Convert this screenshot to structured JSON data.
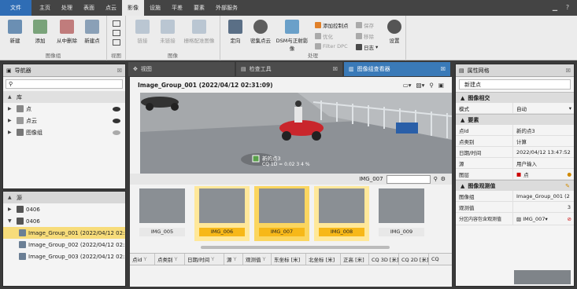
{
  "menu": {
    "tabs": [
      "文件",
      "主页",
      "处理",
      "表面",
      "点云",
      "影像",
      "设施",
      "平差",
      "要素",
      "外部服务"
    ],
    "active": "影像"
  },
  "ribbon": {
    "groups": [
      {
        "label": "图像组",
        "buttons": [
          "新建",
          "添加",
          "从中删除",
          "新建点"
        ]
      },
      {
        "label": "视图",
        "buttons": []
      },
      {
        "label": "图像",
        "buttons": [
          "链接",
          "未链接",
          "栅格配准图像"
        ]
      },
      {
        "label": "处理",
        "buttons": [
          "定向",
          "密集点云",
          "DSM与正射影像"
        ]
      }
    ],
    "small": {
      "add_cp": "添加控制点",
      "save": "保存",
      "optimize": "优化",
      "remove": "移除",
      "filter_dpc": "Filter DPC",
      "log": "日志",
      "settings": "设置"
    }
  },
  "navigator": {
    "title": "导航器",
    "library_label": "库",
    "library_items": [
      "点",
      "点云",
      "图像组"
    ],
    "source_label": "源",
    "source_items": [
      "0406",
      "0406"
    ],
    "groups": [
      "Image_Group_001 (2022/04/12 02:",
      "Image_Group_002 (2022/04/12 02:",
      "Image_Group_003 (2022/04/12 02:"
    ]
  },
  "center_tabs": [
    "视图",
    "检查工具",
    "图像组查看器"
  ],
  "viewer": {
    "title": "Image_Group_001 (2022/04/12 02:31:09)",
    "photo_label": "新的点3",
    "photo_label2": "CQ 1D = 0.02 3 4 %",
    "current_image": "IMG_007",
    "thumbnails": [
      {
        "label": "IMG_005",
        "state": "normal"
      },
      {
        "label": "IMG_006",
        "state": "sel"
      },
      {
        "label": "IMG_007",
        "state": "cur"
      },
      {
        "label": "IMG_008",
        "state": "sel"
      },
      {
        "label": "IMG_009",
        "state": "normal"
      }
    ],
    "grid_columns": [
      "点id",
      "点类别",
      "日期/时间",
      "源",
      "观测值",
      "东坐标 [米]",
      "北坐标 [米]",
      "正高 [米]",
      "CQ 3D [米]",
      "CQ 2D [米]",
      "CQ"
    ]
  },
  "properties": {
    "title": "属性网格",
    "selector": "新建点",
    "sections": [
      {
        "title": "图像相交",
        "rows": [
          {
            "k": "模式",
            "v": "自动"
          }
        ]
      },
      {
        "title": "要素",
        "rows": [
          {
            "k": "点Id",
            "v": "新的点3"
          },
          {
            "k": "点类别",
            "v": "计算"
          },
          {
            "k": "日期/时间",
            "v": "2022/04/12 13:47:52"
          },
          {
            "k": "源",
            "v": "用户输入"
          },
          {
            "k": "图层",
            "v": "点"
          }
        ]
      },
      {
        "title": "图像观测值",
        "rows": [
          {
            "k": "图像组",
            "v": "Image_Group_001 (2"
          },
          {
            "k": "观测值",
            "v": "3"
          },
          {
            "k": "分区内容包含观测值",
            "v": "IMG_007"
          }
        ]
      }
    ]
  },
  "colors": {
    "accent": "#2f6db5",
    "tab_active": "#3a7ab8",
    "thumb_selected": "#f7b818"
  }
}
